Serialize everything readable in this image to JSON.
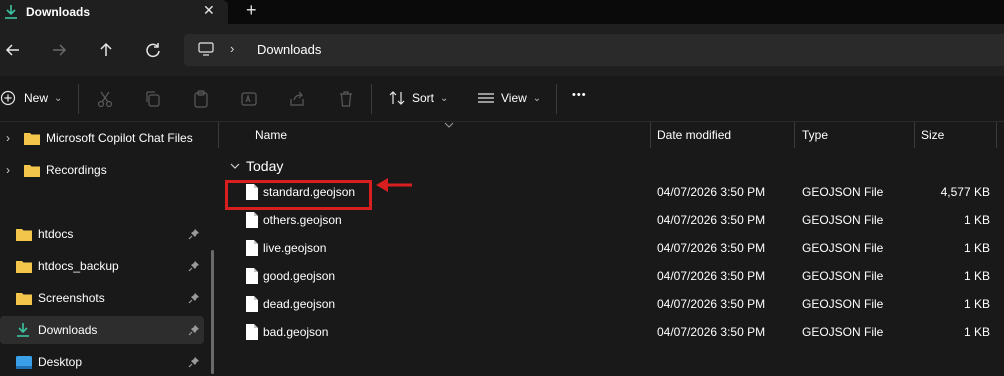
{
  "tab": {
    "title": "Downloads",
    "close": "✕",
    "new": "+"
  },
  "address": {
    "location": "Downloads",
    "chevron": "›"
  },
  "toolbar": {
    "new_label": "New",
    "sort_label": "Sort",
    "view_label": "View",
    "more": "•••",
    "dropdown": "⌄"
  },
  "sidebar": {
    "items": [
      {
        "label": "Microsoft Copilot Chat Files",
        "expandable": true,
        "pinned": false,
        "selected": false,
        "icon": "folder-icon"
      },
      {
        "label": "Recordings",
        "expandable": true,
        "pinned": false,
        "selected": false,
        "icon": "folder-icon"
      },
      {
        "label": "htdocs",
        "expandable": false,
        "pinned": true,
        "selected": false,
        "icon": "folder-icon"
      },
      {
        "label": "htdocs_backup",
        "expandable": false,
        "pinned": true,
        "selected": false,
        "icon": "folder-icon"
      },
      {
        "label": "Screenshots",
        "expandable": false,
        "pinned": true,
        "selected": false,
        "icon": "folder-icon"
      },
      {
        "label": "Downloads",
        "expandable": false,
        "pinned": true,
        "selected": true,
        "icon": "download-icon"
      },
      {
        "label": "Desktop",
        "expandable": false,
        "pinned": true,
        "selected": false,
        "icon": "desktop-icon"
      }
    ],
    "chevron": "›"
  },
  "columns": {
    "name": "Name",
    "date": "Date modified",
    "type": "Type",
    "size": "Size"
  },
  "group": {
    "label": "Today",
    "chevron": "⌄"
  },
  "files": [
    {
      "name": "standard.geojson",
      "date": "04/07/2026 3:50 PM",
      "type": "GEOJSON File",
      "size": "4,577 KB"
    },
    {
      "name": "others.geojson",
      "date": "04/07/2026 3:50 PM",
      "type": "GEOJSON File",
      "size": "1 KB"
    },
    {
      "name": "live.geojson",
      "date": "04/07/2026 3:50 PM",
      "type": "GEOJSON File",
      "size": "1 KB"
    },
    {
      "name": "good.geojson",
      "date": "04/07/2026 3:50 PM",
      "type": "GEOJSON File",
      "size": "1 KB"
    },
    {
      "name": "dead.geojson",
      "date": "04/07/2026 3:50 PM",
      "type": "GEOJSON File",
      "size": "1 KB"
    },
    {
      "name": "bad.geojson",
      "date": "04/07/2026 3:50 PM",
      "type": "GEOJSON File",
      "size": "1 KB"
    }
  ],
  "colors": {
    "accent_green": "#3cc4a0",
    "folder_yellow": "#f3c54a",
    "highlight_red": "#d81e1e"
  }
}
